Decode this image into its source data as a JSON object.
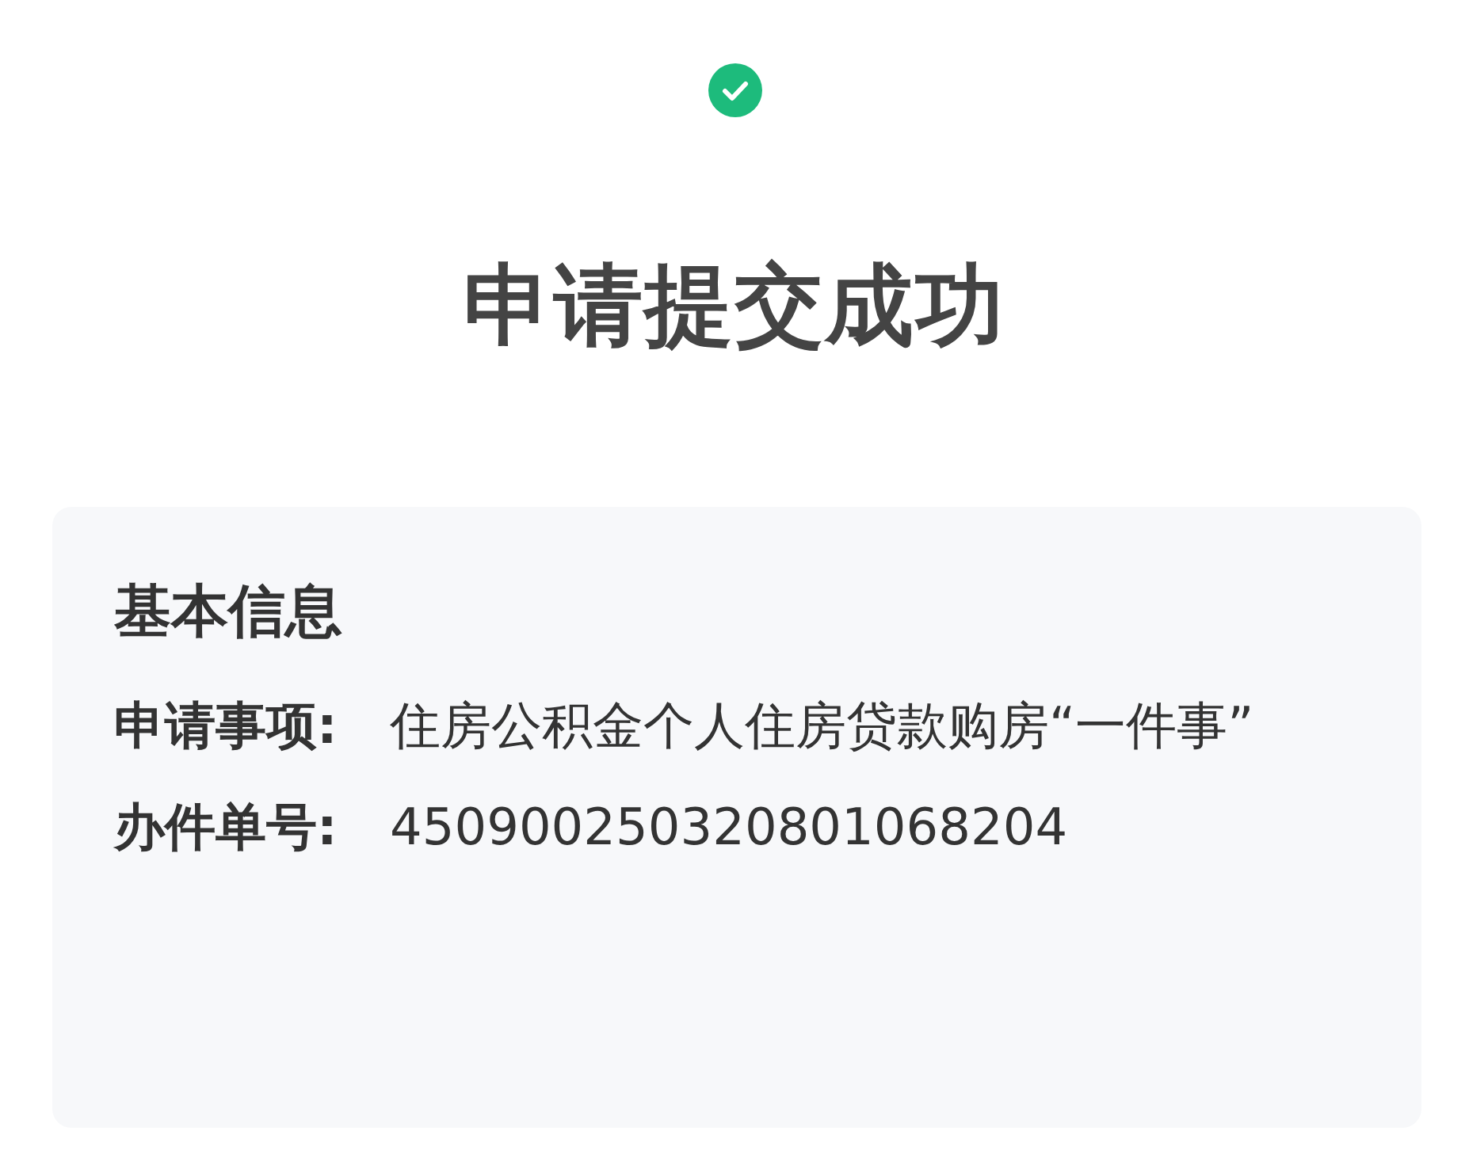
{
  "status": {
    "title": "申请提交成功"
  },
  "card": {
    "heading": "基本信息",
    "rows": [
      {
        "label": "申请事项:",
        "value": "住房公积金个人住房贷款购房“一件事”"
      },
      {
        "label": "办件单号:",
        "value": "450900250320801068204"
      }
    ]
  }
}
